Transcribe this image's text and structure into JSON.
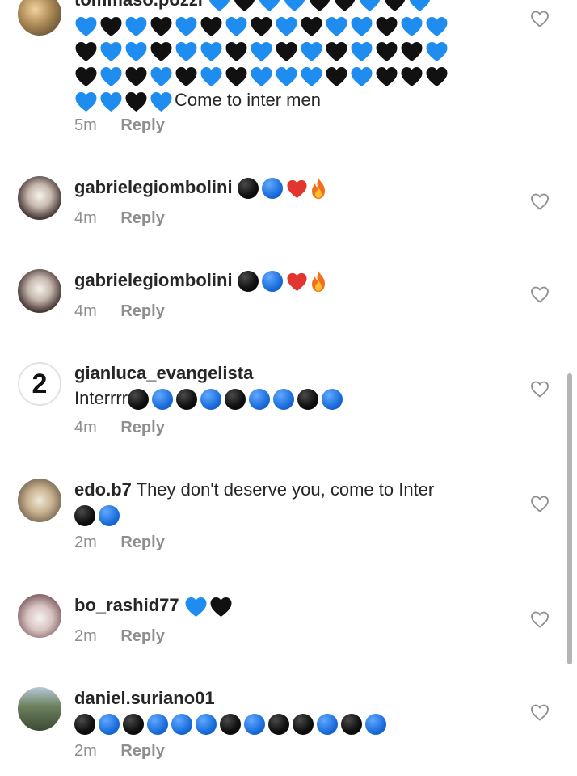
{
  "comments": [
    {
      "username": "tommaso.pozzi",
      "text": "Come to inter men",
      "time": "5m",
      "reply_label": "Reply",
      "avatar": "photo-avatar",
      "emoji_rows": [
        [
          "blue-heart",
          "black-heart",
          "blue-heart",
          "blue-heart",
          "black-heart",
          "black-heart",
          "blue-heart",
          "black-heart",
          "blue-heart"
        ],
        [
          "blue-heart",
          "black-heart",
          "blue-heart",
          "black-heart",
          "blue-heart",
          "black-heart",
          "blue-heart",
          "black-heart",
          "blue-heart",
          "black-heart",
          "blue-heart",
          "blue-heart",
          "black-heart",
          "blue-heart",
          "blue-heart"
        ],
        [
          "black-heart",
          "blue-heart",
          "blue-heart",
          "black-heart",
          "blue-heart",
          "blue-heart",
          "black-heart",
          "blue-heart",
          "black-heart",
          "blue-heart",
          "black-heart",
          "blue-heart",
          "black-heart",
          "black-heart",
          "blue-heart"
        ],
        [
          "black-heart",
          "blue-heart",
          "black-heart",
          "blue-heart",
          "black-heart",
          "blue-heart",
          "black-heart",
          "blue-heart",
          "blue-heart",
          "blue-heart",
          "black-heart",
          "blue-heart",
          "black-heart",
          "black-heart",
          "black-heart"
        ],
        [
          "blue-heart",
          "blue-heart",
          "black-heart",
          "blue-heart"
        ]
      ]
    },
    {
      "username": "gabrielegiombolini",
      "time": "4m",
      "reply_label": "Reply",
      "avatar": "photo-avatar",
      "emoji_inline": [
        "black-circle",
        "blue-circle",
        "red-heart",
        "fire"
      ]
    },
    {
      "username": "gabrielegiombolini",
      "time": "4m",
      "reply_label": "Reply",
      "avatar": "photo-avatar",
      "emoji_inline": [
        "black-circle",
        "blue-circle",
        "red-heart",
        "fire"
      ]
    },
    {
      "username": "gianluca_evangelista",
      "text": "Interrrr",
      "time": "4m",
      "reply_label": "Reply",
      "avatar_text": "2",
      "emoji_inline": [
        "black-circle",
        "blue-circle",
        "black-circle",
        "blue-circle",
        "black-circle",
        "blue-circle",
        "blue-circle",
        "black-circle",
        "blue-circle"
      ]
    },
    {
      "username": "edo.b7",
      "text": "They don't deserve you, come to Inter",
      "time": "2m",
      "reply_label": "Reply",
      "avatar": "photo-avatar",
      "emoji_inline": [
        "black-circle",
        "blue-circle"
      ]
    },
    {
      "username": "bo_rashid77",
      "time": "2m",
      "reply_label": "Reply",
      "avatar": "photo-avatar",
      "emoji_inline": [
        "blue-heart",
        "black-heart"
      ]
    },
    {
      "username": "daniel.suriano01",
      "time": "2m",
      "reply_label": "Reply",
      "avatar": "photo-avatar",
      "emoji_inline": [
        "black-circle",
        "blue-circle",
        "black-circle",
        "blue-circle",
        "blue-circle",
        "blue-circle",
        "black-circle",
        "blue-circle",
        "black-circle",
        "black-circle",
        "blue-circle",
        "black-circle",
        "blue-circle"
      ]
    }
  ],
  "icons": {
    "like": "heart-outline-icon",
    "avatar": "profile-photo"
  },
  "colors": {
    "text": "#262626",
    "secondary": "#8e8e8e",
    "blue_heart": "#1f8cf0",
    "black_heart": "#111111",
    "blue_circle": "#1a6ddb",
    "red_heart": "#e0362f",
    "scrollbar": "#b5b5b5"
  }
}
